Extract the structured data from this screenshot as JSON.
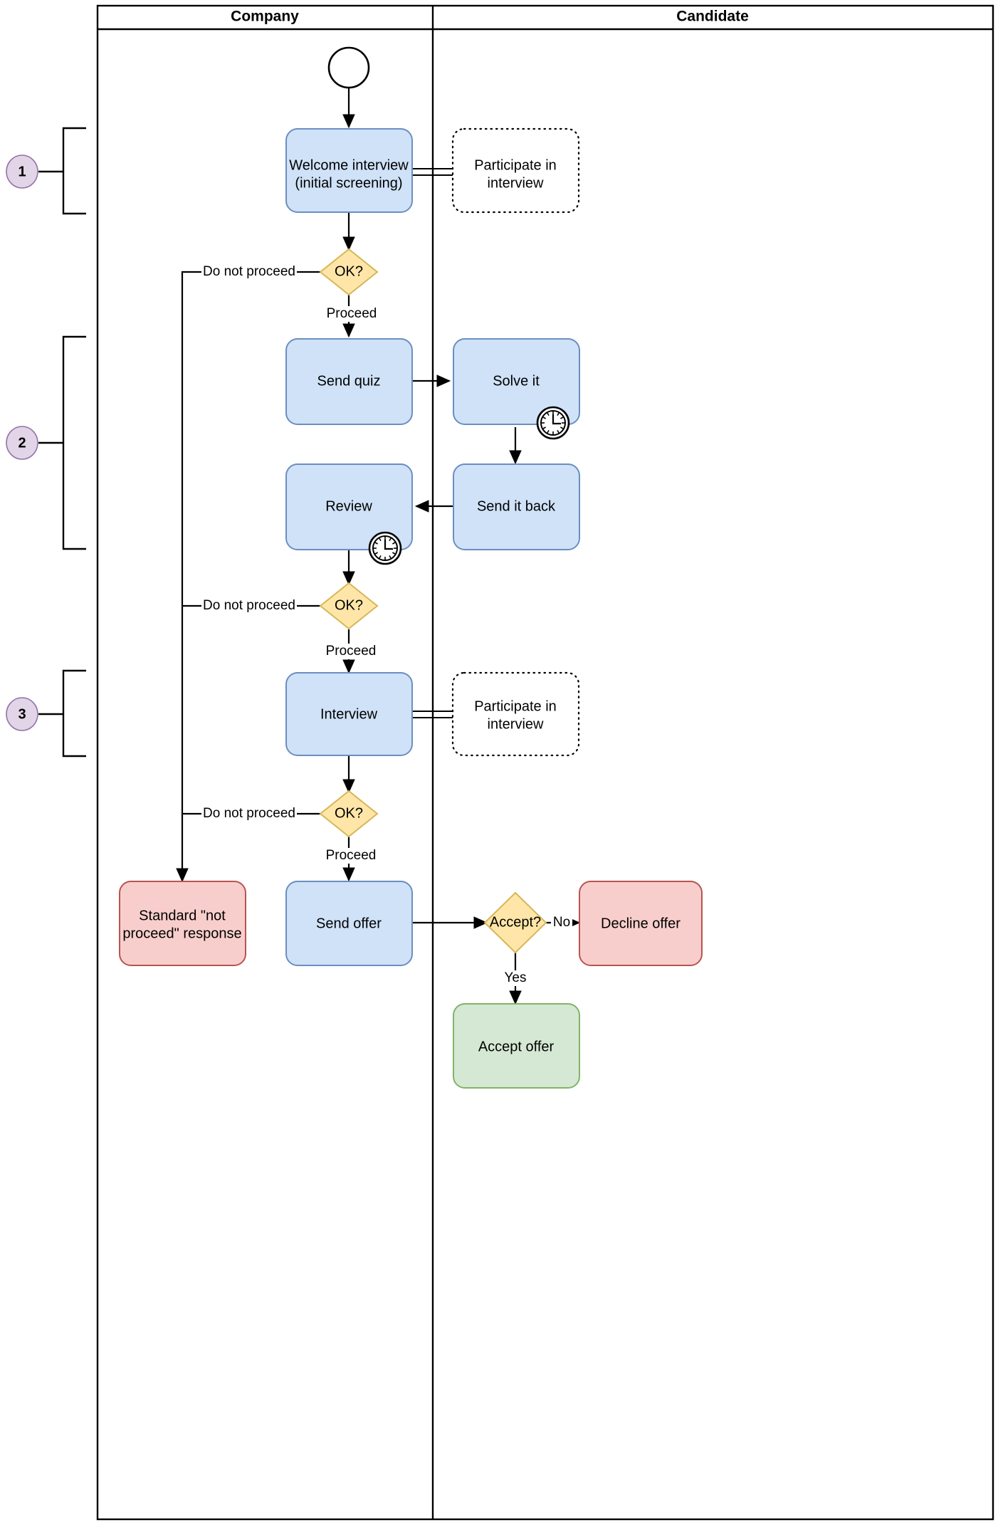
{
  "diagram": {
    "title": "Hiring process swimlane flowchart",
    "lanes": [
      {
        "id": "company",
        "title": "Company"
      },
      {
        "id": "candidate",
        "title": "Candidate"
      }
    ],
    "phase_badges": [
      {
        "id": "phase-1",
        "label": "1"
      },
      {
        "id": "phase-2",
        "label": "2"
      },
      {
        "id": "phase-3",
        "label": "3"
      }
    ],
    "nodes": [
      {
        "id": "start",
        "type": "start-event",
        "label": "",
        "lane": "company"
      },
      {
        "id": "welcome-interview",
        "type": "task",
        "label_line1": "Welcome interview",
        "label_line2": "(initial screening)",
        "lane": "company",
        "color": "#cfe2f7",
        "stroke": "#6c8ebf"
      },
      {
        "id": "participate-1",
        "type": "task-dotted",
        "label_line1": "Participate in",
        "label_line2": "interview",
        "lane": "candidate",
        "color": "#ffffff",
        "stroke": "#000000"
      },
      {
        "id": "ok-1",
        "type": "gateway",
        "label": "OK?",
        "lane": "company",
        "color": "#ffe6a8",
        "stroke": "#d6b656"
      },
      {
        "id": "send-quiz",
        "type": "task",
        "label_line1": "Send quiz",
        "label_line2": "",
        "lane": "company",
        "color": "#cfe2f7",
        "stroke": "#6c8ebf"
      },
      {
        "id": "solve-it",
        "type": "task",
        "label_line1": "Solve it",
        "label_line2": "",
        "lane": "candidate",
        "color": "#cfe2f7",
        "stroke": "#6c8ebf",
        "marker": "timer-icon"
      },
      {
        "id": "send-it-back",
        "type": "task",
        "label_line1": "Send it back",
        "label_line2": "",
        "lane": "candidate",
        "color": "#cfe2f7",
        "stroke": "#6c8ebf"
      },
      {
        "id": "review",
        "type": "task",
        "label_line1": "Review",
        "label_line2": "",
        "lane": "company",
        "color": "#cfe2f7",
        "stroke": "#6c8ebf",
        "marker": "timer-icon"
      },
      {
        "id": "ok-2",
        "type": "gateway",
        "label": "OK?",
        "lane": "company",
        "color": "#ffe6a8",
        "stroke": "#d6b656"
      },
      {
        "id": "interview",
        "type": "task",
        "label_line1": "Interview",
        "label_line2": "",
        "lane": "company",
        "color": "#cfe2f7",
        "stroke": "#6c8ebf"
      },
      {
        "id": "participate-2",
        "type": "task-dotted",
        "label_line1": "Participate in",
        "label_line2": "interview",
        "lane": "candidate",
        "color": "#ffffff",
        "stroke": "#000000"
      },
      {
        "id": "ok-3",
        "type": "gateway",
        "label": "OK?",
        "lane": "company",
        "color": "#ffe6a8",
        "stroke": "#d6b656"
      },
      {
        "id": "standard-response",
        "type": "task",
        "label_line1": "Standard \"not",
        "label_line2": "proceed\" response",
        "lane": "company",
        "color": "#f8cecc",
        "stroke": "#b85450"
      },
      {
        "id": "send-offer",
        "type": "task",
        "label_line1": "Send offer",
        "label_line2": "",
        "lane": "company",
        "color": "#cfe2f7",
        "stroke": "#6c8ebf"
      },
      {
        "id": "accept",
        "type": "gateway",
        "label": "Accept?",
        "lane": "candidate",
        "color": "#ffe6a8",
        "stroke": "#d6b656"
      },
      {
        "id": "decline-offer",
        "type": "task",
        "label_line1": "Decline offer",
        "label_line2": "",
        "lane": "candidate",
        "color": "#f8cecc",
        "stroke": "#b85450"
      },
      {
        "id": "accept-offer",
        "type": "task",
        "label_line1": "Accept offer",
        "label_line2": "",
        "lane": "candidate",
        "color": "#d5e8d4",
        "stroke": "#82b366"
      }
    ],
    "edge_labels": {
      "do_not_proceed_1": "Do not proceed",
      "do_not_proceed_2": "Do not proceed",
      "do_not_proceed_3": "Do not proceed",
      "proceed_1": "Proceed",
      "proceed_2": "Proceed",
      "proceed_3": "Proceed",
      "no": "No",
      "yes": "Yes"
    },
    "colors": {
      "task_blue_fill": "#cfe2f7",
      "task_blue_stroke": "#6c8ebf",
      "gateway_fill": "#ffe6a8",
      "gateway_stroke": "#d6b656",
      "red_fill": "#f8cecc",
      "red_stroke": "#b85450",
      "green_fill": "#d5e8d4",
      "green_stroke": "#82b366",
      "badge_fill": "#e1d5e7",
      "badge_stroke": "#9673a6",
      "line": "#000000"
    }
  }
}
